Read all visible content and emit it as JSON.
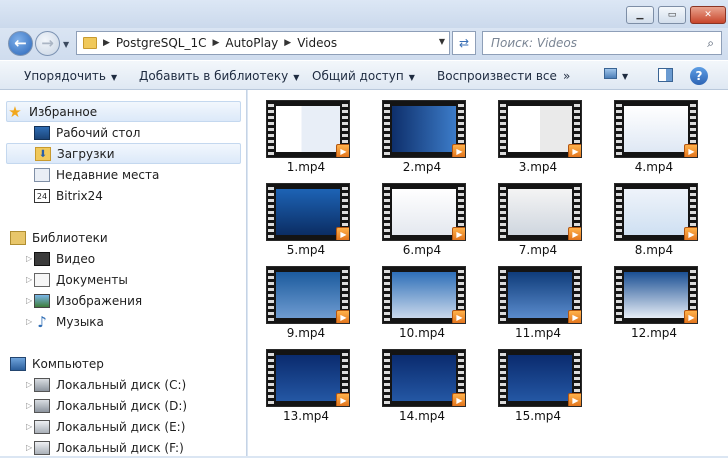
{
  "address": {
    "crumbs": [
      "PostgreSQL_1C",
      "AutoPlay",
      "Videos"
    ],
    "search_placeholder": "Поиск: Videos"
  },
  "toolbar": {
    "organize": "Упорядочить",
    "add_to_library": "Добавить в библиотеку",
    "share": "Общий доступ",
    "play_all": "Воспроизвести все",
    "more": "»"
  },
  "sidebar": {
    "favorites": {
      "header": "Избранное",
      "items": [
        "Рабочий стол",
        "Загрузки",
        "Недавние места",
        "Bitrix24"
      ]
    },
    "libraries": {
      "header": "Библиотеки",
      "items": [
        "Видео",
        "Документы",
        "Изображения",
        "Музыка"
      ]
    },
    "computer": {
      "header": "Компьютер",
      "items": [
        "Локальный диск (C:)",
        "Локальный диск (D:)",
        "Локальный диск (E:)",
        "Локальный диск (F:)"
      ]
    }
  },
  "files": [
    "1.mp4",
    "2.mp4",
    "3.mp4",
    "4.mp4",
    "5.mp4",
    "6.mp4",
    "7.mp4",
    "8.mp4",
    "9.mp4",
    "10.mp4",
    "11.mp4",
    "12.mp4",
    "13.mp4",
    "14.mp4",
    "15.mp4"
  ],
  "colors": {
    "selection": "#dce9f9",
    "play_badge": "#f08a24"
  }
}
